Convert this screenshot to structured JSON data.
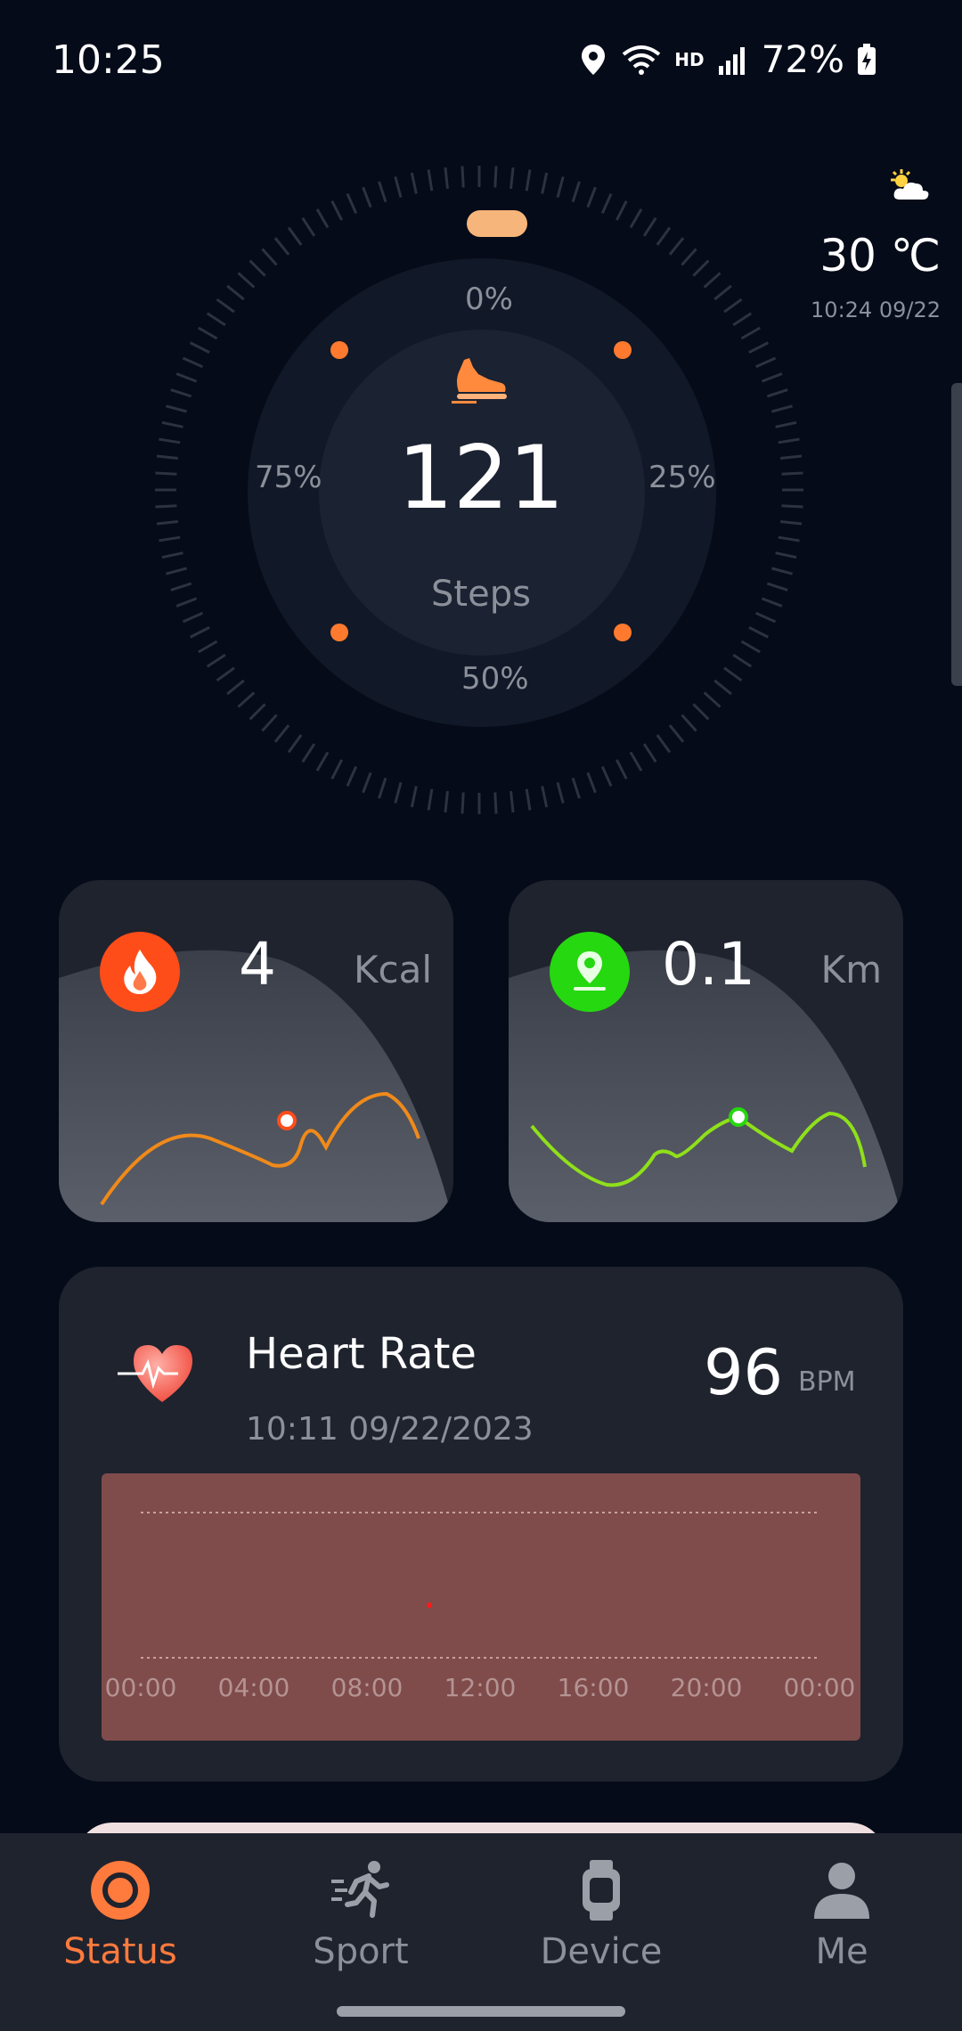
{
  "status_bar": {
    "time": "10:25",
    "battery": "72%",
    "network_badge": "HD",
    "icons": [
      "location-icon",
      "wifi-icon",
      "signal-icon",
      "battery-charging-icon"
    ]
  },
  "steps": {
    "value": "121",
    "label": "Steps",
    "progress_labels": {
      "p0": "0%",
      "p25": "25%",
      "p50": "50%",
      "p75": "75%"
    },
    "icon": "shoe-icon",
    "accent": "#ff7a2e"
  },
  "weather": {
    "temperature": "30 ℃",
    "updated": "10:24 09/22",
    "icon": "partly-sunny-icon"
  },
  "calories": {
    "value": "4",
    "unit": "Kcal",
    "icon": "flame-icon",
    "color": "#ff4d1a"
  },
  "distance": {
    "value": "0.1",
    "unit": "Km",
    "icon": "location-pin-icon",
    "color": "#25d80f"
  },
  "heart_rate": {
    "title": "Heart Rate",
    "timestamp": "10:11 09/22/2023",
    "value": "96",
    "unit": "BPM",
    "icon": "heart-pulse-icon",
    "chart_ticks": [
      "00:00",
      "04:00",
      "08:00",
      "12:00",
      "16:00",
      "20:00",
      "00:00"
    ]
  },
  "nav": {
    "items": [
      {
        "label": "Status",
        "icon": "status-ring-icon",
        "active": true
      },
      {
        "label": "Sport",
        "icon": "running-person-icon",
        "active": false
      },
      {
        "label": "Device",
        "icon": "watch-icon",
        "active": false
      },
      {
        "label": "Me",
        "icon": "person-icon",
        "active": false
      }
    ],
    "active_color": "#ff7a3d"
  }
}
